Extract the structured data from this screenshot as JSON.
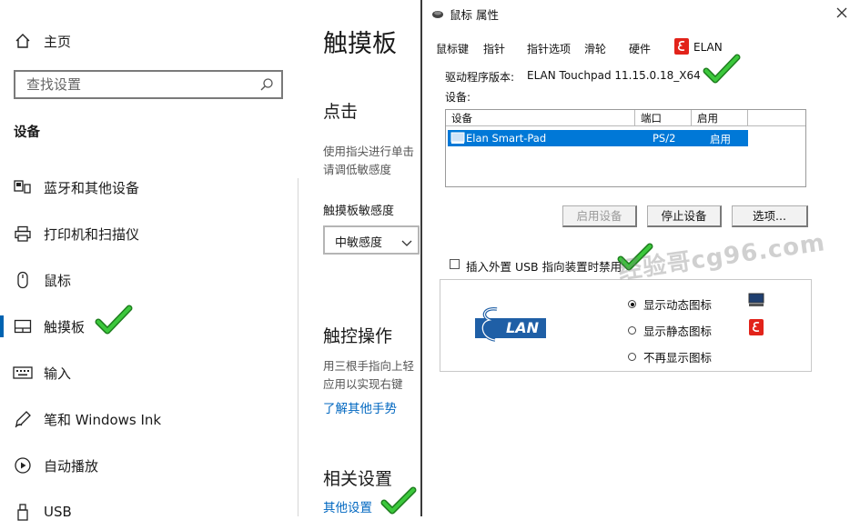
{
  "sidebar": {
    "home_label": "主页",
    "search_placeholder": "查找设置",
    "section_title": "设备",
    "items": [
      {
        "label": "蓝牙和其他设备",
        "icon": "bluetooth-devices-icon"
      },
      {
        "label": "打印机和扫描仪",
        "icon": "printer-icon"
      },
      {
        "label": "鼠标",
        "icon": "mouse-icon"
      },
      {
        "label": "触摸板",
        "icon": "touchpad-icon",
        "active": true
      },
      {
        "label": "输入",
        "icon": "keyboard-icon"
      },
      {
        "label": "笔和 Windows Ink",
        "icon": "pen-icon"
      },
      {
        "label": "自动播放",
        "icon": "autoplay-icon"
      },
      {
        "label": "USB",
        "icon": "usb-icon"
      }
    ]
  },
  "main": {
    "title": "触摸板",
    "click_heading": "点击",
    "click_desc_line1": "使用指尖进行单击",
    "click_desc_line2": "请调低敏感度",
    "sensitivity_label": "触摸板敏感度",
    "sensitivity_value": "中敏感度",
    "gestures_heading": "触控操作",
    "gestures_desc_line1": "用三根手指向上轻",
    "gestures_desc_line2": "应用以实现右键",
    "gestures_link": "了解其他手势",
    "related_heading": "相关设置",
    "related_link": "其他设置"
  },
  "dialog": {
    "title": "鼠标 属性",
    "tabs": [
      "鼠标键",
      "指针",
      "指针选项",
      "滑轮",
      "硬件",
      "ELAN"
    ],
    "active_tab": "ELAN",
    "driver_label": "驱动程序版本:",
    "driver_value": "ELAN Touchpad 11.15.0.18_X64",
    "devices_label": "设备:",
    "columns": [
      "设备",
      "端口",
      "启用"
    ],
    "device_row": {
      "name": "Elan Smart-Pad",
      "port": "PS/2",
      "enabled": "启用"
    },
    "buttons": {
      "enable": "启用设备",
      "disable": "停止设备",
      "options": "选项..."
    },
    "usb_checkbox_label": "插入外置 USB 指向装置时禁用",
    "logo_text": "LAN",
    "tray_options": [
      "显示动态图标",
      "显示静态图标",
      "不再显示图标"
    ],
    "tray_selected": 0
  },
  "watermark_text": "经验哥cg96.com",
  "colors": {
    "accent": "#0063b1",
    "link": "#0067c0",
    "selection": "#0078d7",
    "check_green": "#2bb32b",
    "elan_red": "#e2231a",
    "elan_blue": "#1f5fa6"
  }
}
